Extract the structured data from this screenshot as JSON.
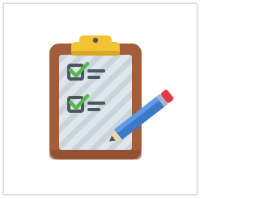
{
  "icon": {
    "name": "clipboard-checklist-icon",
    "colors": {
      "board": "#a35d3b",
      "board_shadow": "#8a4a2c",
      "paper": "#dde6ec",
      "paper_stripes": "#c9d5dd",
      "clip": "#f2c335",
      "clip_shadow": "#d9a91d",
      "check_box": "#4e5660",
      "check_mark": "#53b94a",
      "lines": "#4e5660",
      "pencil_body": "#3e78c8",
      "pencil_light": "#5d9be6",
      "pencil_eraser": "#e2384b",
      "pencil_wood": "#f1d7a8",
      "pencil_tip": "#4e5660"
    }
  }
}
